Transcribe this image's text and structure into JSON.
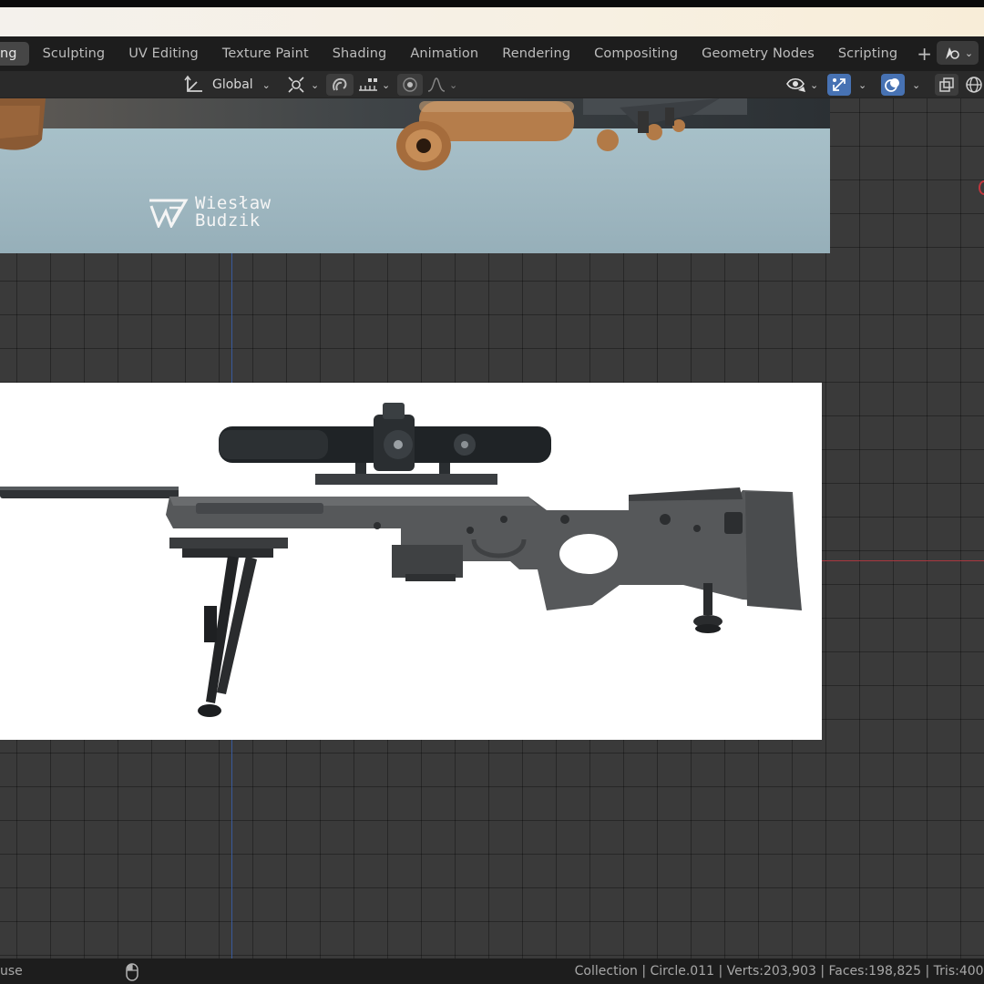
{
  "workspace_tabs": [
    {
      "label": "ng",
      "active": true
    },
    {
      "label": "Sculpting"
    },
    {
      "label": "UV Editing"
    },
    {
      "label": "Texture Paint"
    },
    {
      "label": "Shading"
    },
    {
      "label": "Animation"
    },
    {
      "label": "Rendering"
    },
    {
      "label": "Compositing"
    },
    {
      "label": "Geometry Nodes"
    },
    {
      "label": "Scripting"
    }
  ],
  "workspace_add": "+",
  "header": {
    "transform_orientation": "Global",
    "icons": [
      "transform-orientation-icon",
      "pivot-point-icon",
      "snap-icon",
      "snap-increment-icon",
      "proportional-edit-icon",
      "falloff-icon",
      "visibility-icon",
      "gizmo-icon",
      "overlay-icon",
      "xray-icon",
      "wireframe-shading-icon"
    ]
  },
  "reference_images": {
    "top_logo_line1": "Wiesław",
    "top_logo_line2": "Budzik"
  },
  "status_bar": {
    "left_text": "use",
    "right_text": "Collection | Circle.011 | Verts:203,903 | Faces:198,825 | Tris:400,"
  },
  "colors": {
    "accent_blue": "#4772b3",
    "axis_x": "#a8383f",
    "axis_y": "#3a5ea6",
    "viewport_bg": "#3a3a3a"
  }
}
